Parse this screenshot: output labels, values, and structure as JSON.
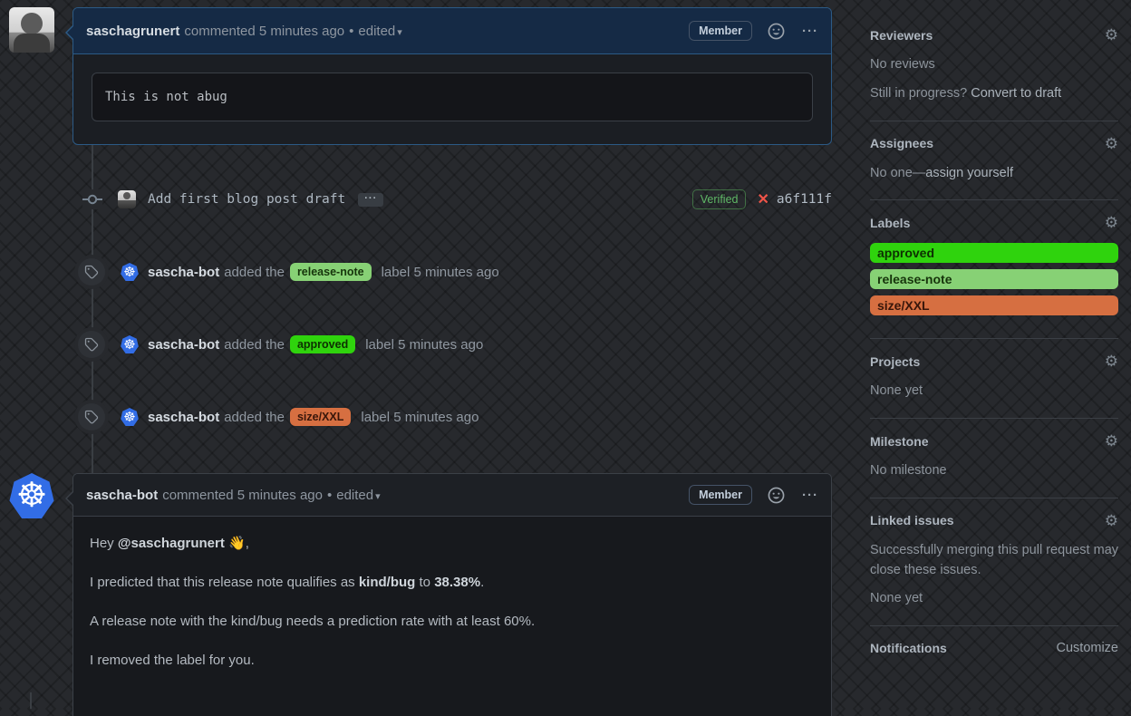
{
  "comment1": {
    "author": "saschagrunert",
    "meta": "commented 5 minutes ago",
    "dot": "•",
    "edited": "edited",
    "edit_caret": "▾",
    "member": "Member",
    "kebab": "···",
    "code": "This is not abug"
  },
  "commit": {
    "message": "Add first blog post draft",
    "expander": "···",
    "verified": "Verified",
    "fail_x": "✕",
    "hash": "a6f111f"
  },
  "events": [
    {
      "actor": "sascha-bot",
      "pre": "added the",
      "label": "release-note",
      "post": "label 5 minutes ago",
      "bg": "#87d175",
      "fg": "#16340b"
    },
    {
      "actor": "sascha-bot",
      "pre": "added the",
      "label": "approved",
      "post": "label 5 minutes ago",
      "bg": "#2fd30d",
      "fg": "#0d3002"
    },
    {
      "actor": "sascha-bot",
      "pre": "added the",
      "label": "size/XXL",
      "post": "label 5 minutes ago",
      "bg": "#d66f41",
      "fg": "#38160a"
    }
  ],
  "comment2": {
    "author": "sascha-bot",
    "meta": "commented 5 minutes ago",
    "dot": "•",
    "edited": "edited",
    "edit_caret": "▾",
    "member": "Member",
    "kebab": "···",
    "p1_pre": "Hey ",
    "p1_mention": "@saschagrunert",
    "p1_post": " 👋,",
    "p2_pre": "I predicted that this release note qualifies as ",
    "p2_bold1": "kind/bug",
    "p2_mid": " to ",
    "p2_bold2": "38.38%",
    "p2_post": ".",
    "p3": "A release note with the kind/bug needs a prediction rate with at least 60%.",
    "p4": "I removed the label for you."
  },
  "sidebar": {
    "reviewers": {
      "title": "Reviewers",
      "empty": "No reviews",
      "draft_pre": "Still in progress? ",
      "draft_link": "Convert to draft"
    },
    "assignees": {
      "title": "Assignees",
      "empty_pre": "No one—",
      "empty_link": "assign yourself"
    },
    "labels": {
      "title": "Labels",
      "items": [
        {
          "name": "approved",
          "bg": "#2fd30d",
          "fg": "#0d3002"
        },
        {
          "name": "release-note",
          "bg": "#87d175",
          "fg": "#16340b"
        },
        {
          "name": "size/XXL",
          "bg": "#d66f41",
          "fg": "#38160a"
        }
      ]
    },
    "projects": {
      "title": "Projects",
      "empty": "None yet"
    },
    "milestone": {
      "title": "Milestone",
      "empty": "No milestone"
    },
    "linked_issues": {
      "title": "Linked issues",
      "desc": "Successfully merging this pull request may close these issues.",
      "empty": "None yet"
    },
    "notifications": {
      "title": "Notifications",
      "customize": "Customize"
    }
  },
  "icons": {
    "k8s_wheel": "☸",
    "gear": "⚙"
  }
}
